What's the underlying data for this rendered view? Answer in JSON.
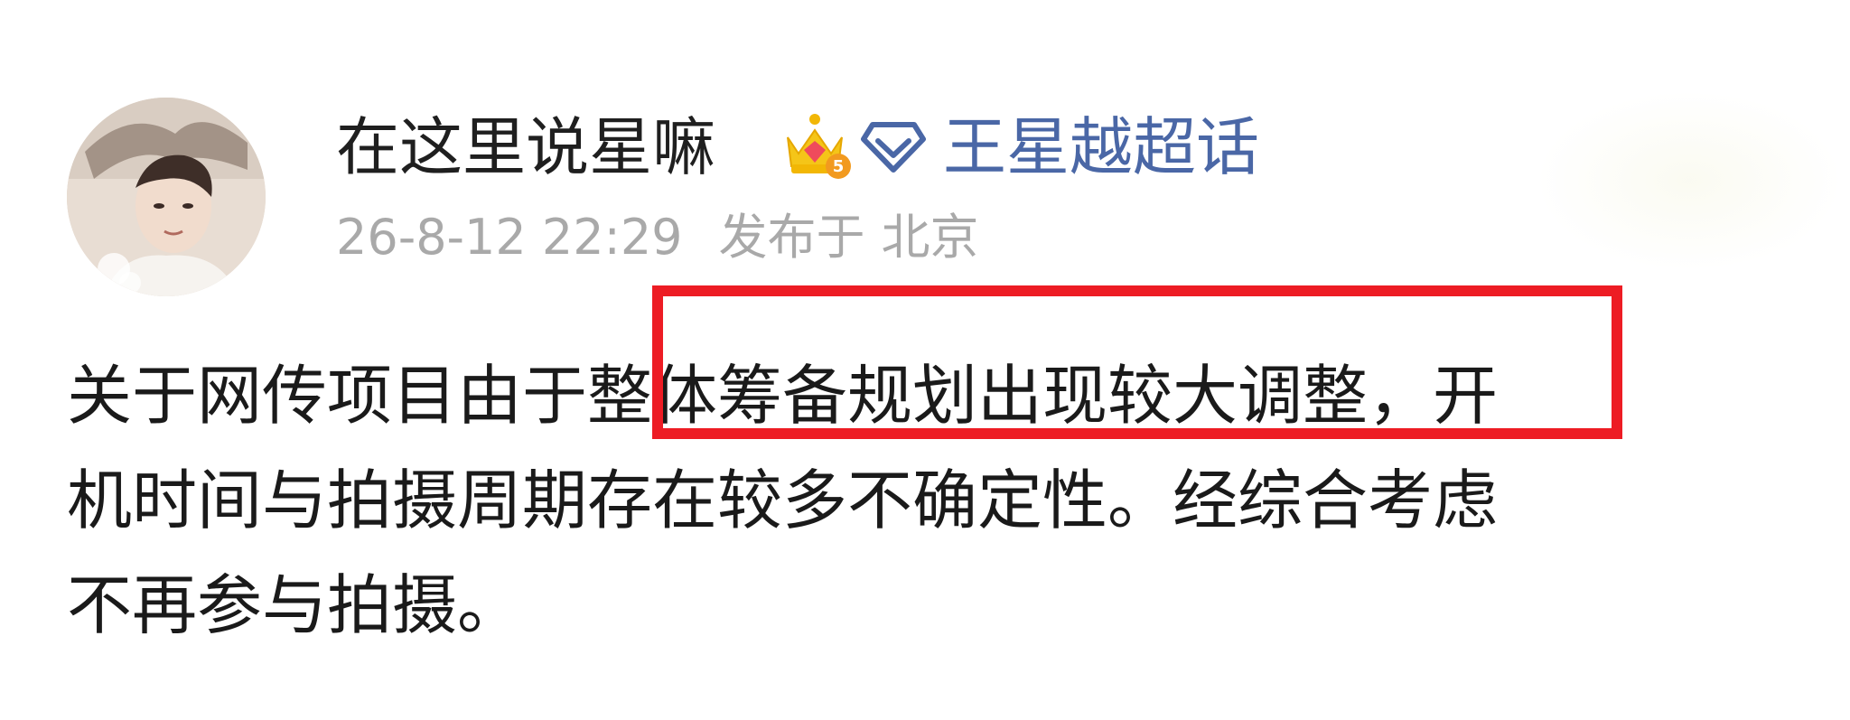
{
  "post": {
    "author": {
      "name": "在这里说星嘛",
      "badge_icon": "crown-level-5-icon",
      "badge_level": "5"
    },
    "topic": {
      "icon": "diamond-icon",
      "label": "王星越超话"
    },
    "meta": {
      "timestamp": "26-8-12 22:29",
      "location_prefix": "发布于",
      "location": "北京"
    },
    "content_lines": [
      "关于网传项目由于整体筹备规划出现较大调整，开",
      "机时间与拍摄周期存在较多不确定性。经综合考虑",
      "不再参与拍摄。"
    ],
    "colors": {
      "topic_link": "#4a67a6",
      "meta_text": "#a9a9a9",
      "highlight_border": "#ed1c24",
      "crown": "#f2b705"
    }
  }
}
